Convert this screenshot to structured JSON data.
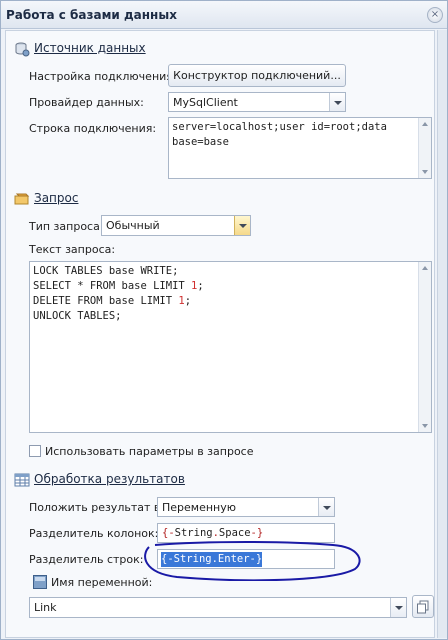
{
  "window": {
    "title": "Работа с базами данных",
    "close": "×"
  },
  "source": {
    "header": "Источник данных",
    "conn_setup_label": "Настройка подключения:",
    "conn_builder_button": "Конструктор подключений...",
    "provider_label": "Провайдер данных:",
    "provider_value": "MySqlClient",
    "conn_string_label": "Строка подключения:",
    "conn_string_line1": "server=localhost;user id=root;data",
    "conn_string_line2": "base=base"
  },
  "query": {
    "header": "Запрос",
    "type_label": "Тип запроса:",
    "type_value": "Обычный",
    "text_label": "Текст запроса:",
    "lines": [
      {
        "pre": "LOCK TABLES base WRITE;",
        "num": "",
        "post": ""
      },
      {
        "pre": "SELECT * FROM base LIMIT ",
        "num": "1",
        "post": ";"
      },
      {
        "pre": "DELETE FROM base LIMIT ",
        "num": "1",
        "post": ";"
      },
      {
        "pre": "UNLOCK TABLES;",
        "num": "",
        "post": ""
      }
    ],
    "use_params_label": "Использовать параметры в запросе",
    "use_params_checked": false
  },
  "results": {
    "header": "Обработка результатов",
    "put_result_label": "Положить результат в:",
    "put_result_value": "Переменную",
    "col_sep_label": "Разделитель колонок:",
    "col_sep_open": "{-",
    "col_sep_class": "String",
    "col_sep_dot": ".",
    "col_sep_member": "Space",
    "col_sep_close": "-}",
    "row_sep_label": "Разделитель строк:",
    "row_sep_open": "{-",
    "row_sep_class": "String",
    "row_sep_dot": ".",
    "row_sep_member": "Enter",
    "row_sep_close": "-}",
    "var_label": "Имя переменной:",
    "var_value": "Link"
  },
  "colors": {
    "accent": "#3a78d8",
    "annotation": "#1a1aa6",
    "error_text": "#b22222"
  }
}
